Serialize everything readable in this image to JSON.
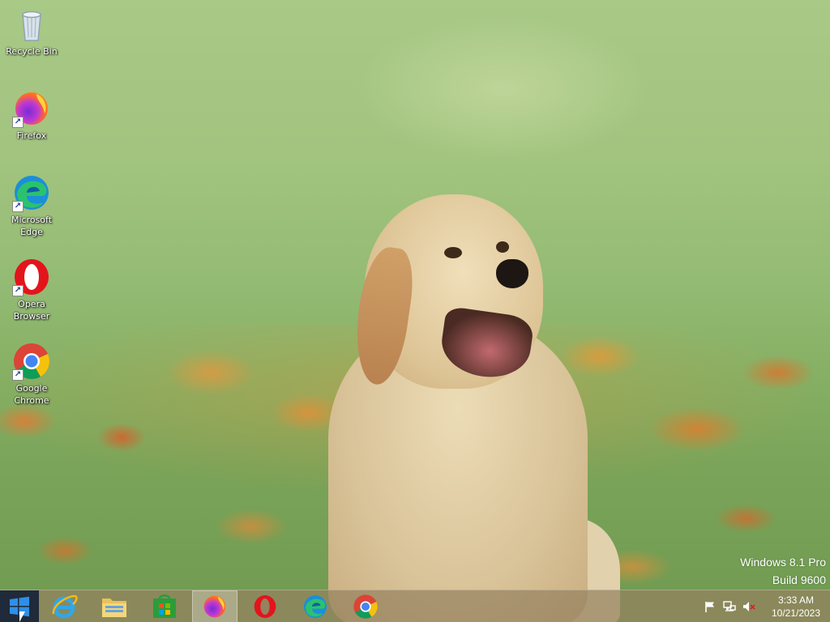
{
  "desktop": {
    "icons": [
      {
        "name": "recycle-bin",
        "label": "Recycle Bin",
        "icon": "recycle-bin-icon"
      },
      {
        "name": "firefox",
        "label": "Firefox",
        "icon": "firefox-icon",
        "shortcut": true
      },
      {
        "name": "microsoft-edge",
        "label": "Microsoft Edge",
        "icon": "edge-icon",
        "shortcut": true
      },
      {
        "name": "opera-browser",
        "label": "Opera Browser",
        "icon": "opera-icon",
        "shortcut": true
      },
      {
        "name": "google-chrome",
        "label": "Google Chrome",
        "icon": "chrome-icon",
        "shortcut": true
      }
    ],
    "wallpaper": "golden retriever puppy in flower field"
  },
  "watermark": {
    "line1": "Windows 8.1 Pro",
    "line2": "Build 9600"
  },
  "taskbar": {
    "start": {
      "icon": "windows-logo-icon"
    },
    "items": [
      {
        "name": "internet-explorer",
        "icon": "internet-explorer-icon",
        "active": false
      },
      {
        "name": "file-explorer",
        "icon": "folder-icon",
        "active": false
      },
      {
        "name": "store",
        "icon": "store-icon",
        "active": false
      },
      {
        "name": "firefox",
        "icon": "firefox-icon",
        "active": true
      },
      {
        "name": "opera",
        "icon": "opera-icon",
        "active": false
      },
      {
        "name": "edge",
        "icon": "edge-icon",
        "active": false
      },
      {
        "name": "chrome",
        "icon": "chrome-icon",
        "active": false
      }
    ],
    "tray": {
      "icons": [
        "flag-icon",
        "network-icon",
        "volume-muted-icon"
      ],
      "time": "3:33 AM",
      "date": "10/21/2023"
    },
    "colors": {
      "taskbar": "#96825f",
      "start": "#1f2a3a"
    }
  }
}
